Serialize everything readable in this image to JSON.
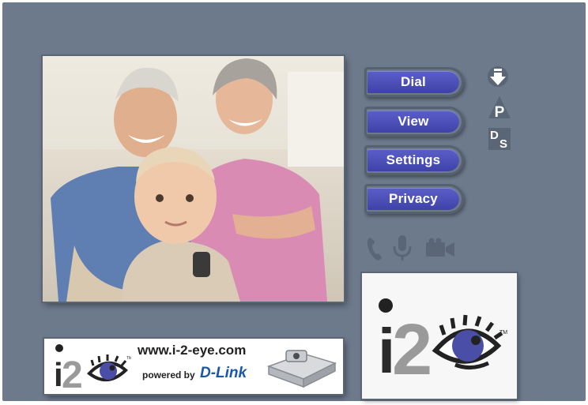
{
  "video": {
    "description_icon": "video-feed"
  },
  "menu": {
    "items": [
      {
        "label": "Dial"
      },
      {
        "label": "View"
      },
      {
        "label": "Settings"
      },
      {
        "label": "Privacy"
      }
    ]
  },
  "side_icons": {
    "download": "download-arrow-icon",
    "p_label": "P",
    "ds_label_d": "D",
    "ds_label_s": "S"
  },
  "status_icons": [
    "phone-icon",
    "microphone-icon",
    "camera-icon"
  ],
  "logo": {
    "text_i": "i",
    "text_2": "2",
    "tm": "TM"
  },
  "banner": {
    "url": "www.i-2-eye.com",
    "powered_by": "powered by",
    "brand": "D-Link",
    "text_i": "i",
    "text_2": "2",
    "tm": "TM"
  },
  "colors": {
    "background": "#6d7a8c",
    "button": "#4a4fb8",
    "eye": "#4b4ea6"
  }
}
